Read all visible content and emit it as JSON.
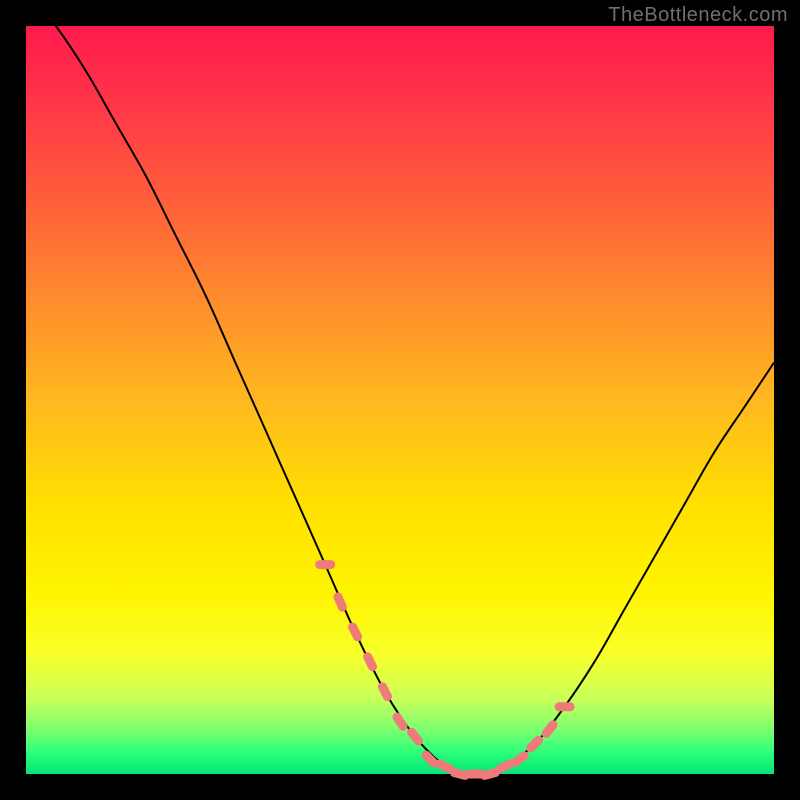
{
  "attribution": "TheBottleneck.com",
  "colors": {
    "frame": "#000000",
    "gradient_top": "#ff1a4d",
    "gradient_mid": "#ffe000",
    "gradient_bottom": "#00e676",
    "curve": "#000000",
    "marker": "#ef7a7a"
  },
  "chart_data": {
    "type": "line",
    "title": "",
    "xlabel": "",
    "ylabel": "",
    "xlim": [
      0,
      100
    ],
    "ylim": [
      0,
      100
    ],
    "series": [
      {
        "name": "bottleneck-curve",
        "x": [
          0,
          4,
          8,
          12,
          16,
          20,
          24,
          28,
          32,
          36,
          40,
          44,
          48,
          52,
          56,
          58,
          60,
          62,
          64,
          68,
          72,
          76,
          80,
          84,
          88,
          92,
          96,
          100
        ],
        "y": [
          105,
          100,
          94,
          87,
          80,
          72,
          64,
          55,
          46,
          37,
          28,
          19,
          11,
          5,
          1,
          0,
          0,
          0,
          1,
          4,
          9,
          15,
          22,
          29,
          36,
          43,
          49,
          55
        ]
      }
    ],
    "markers": {
      "name": "highlight-points",
      "x": [
        40,
        42,
        44,
        46,
        48,
        50,
        52,
        54,
        56,
        58,
        60,
        62,
        64,
        66,
        68,
        70,
        72
      ],
      "y": [
        28,
        23,
        19,
        15,
        11,
        7,
        5,
        2,
        1,
        0,
        0,
        0,
        1,
        2,
        4,
        6,
        9
      ]
    }
  }
}
